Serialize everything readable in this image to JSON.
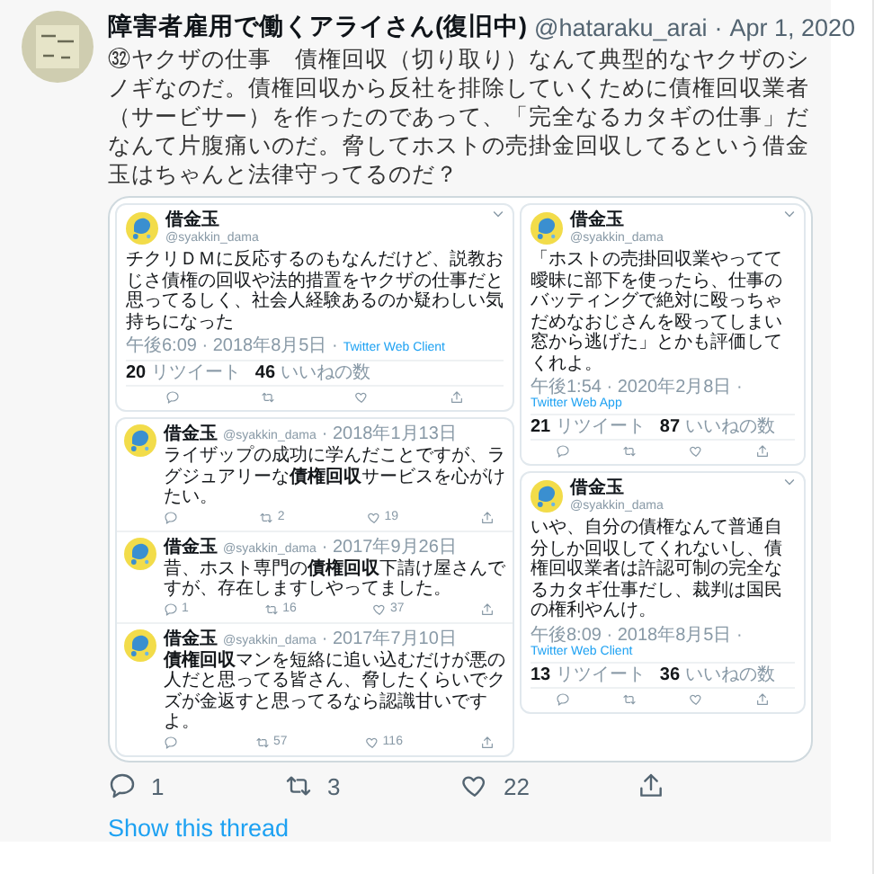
{
  "tweet": {
    "author": "障害者雇用で働くアライさん(復旧中)",
    "handle": "@hataraku_arai",
    "separator": "·",
    "date": "Apr 1, 2020",
    "text": "㉜ヤクザの仕事　債権回収（切り取り）なんて典型的なヤクザのシノギなのだ。債権回収から反社を排除していくために債権回収業者（サービサー）を作ったのであって、「完全なるカタギの仕事」だなんて片腹痛いのだ。脅してホストの売掛金回収してるという借金玉はちゃんと法律守ってるのだ？",
    "image": {
      "columns": [
        {
          "cards": [
            {
              "kind": "detail",
              "name": "借金玉",
              "handle": "@syakkin_dama",
              "text": "チクリＤＭに反応するのもなんだけど、説教おじさ債権の回収や法的措置をヤクザの仕事だと思ってるしく、社会人経験あるのか疑わしい気持ちになった",
              "time": "午後6:09 · 2018年8月5日 ·",
              "app": "Twitter Web Client",
              "stats": [
                {
                  "count": "20",
                  "label": "リツイート"
                },
                {
                  "count": "46",
                  "label": "いいねの数"
                }
              ]
            },
            {
              "kind": "replies",
              "items": [
                {
                  "name": "借金玉",
                  "handle": "@syakkin_dama",
                  "date": "· 2018年1月13日",
                  "text": "ライザップの成功に学んだことですが、ラグジュアリーな**債権回収**サービスを心がけたい。",
                  "actions": [
                    {
                      "kind": "reply"
                    },
                    {
                      "kind": "retweet",
                      "count": "2"
                    },
                    {
                      "kind": "like",
                      "count": "19"
                    },
                    {
                      "kind": "share"
                    }
                  ]
                },
                {
                  "name": "借金玉",
                  "handle": "@syakkin_dama",
                  "date": "· 2017年9月26日",
                  "text": "昔、ホスト専門の**債権回収**下請け屋さんですが、存在しますしやってました。",
                  "actions": [
                    {
                      "kind": "reply",
                      "count": "1"
                    },
                    {
                      "kind": "retweet",
                      "count": "16"
                    },
                    {
                      "kind": "like",
                      "count": "37"
                    },
                    {
                      "kind": "share"
                    }
                  ]
                },
                {
                  "name": "借金玉",
                  "handle": "@syakkin_dama",
                  "date": "· 2017年7月10日",
                  "text": "**債権回収**マンを短絡に追い込むだけが悪の人だと思ってる皆さん、脅したくらいでクズが金返すと思ってるなら認識甘いですよ。",
                  "actions": [
                    {
                      "kind": "reply"
                    },
                    {
                      "kind": "retweet",
                      "count": "57"
                    },
                    {
                      "kind": "like",
                      "count": "116"
                    },
                    {
                      "kind": "share"
                    }
                  ]
                }
              ]
            }
          ]
        },
        {
          "cards": [
            {
              "kind": "detail",
              "name": "借金玉",
              "handle": "@syakkin_dama",
              "text": "「ホストの売掛回収業やってて曖昧に部下を使ったら、仕事のバッティングで絶対に殴っちゃだめなおじさんを殴ってしまい窓から逃げた」とかも評価してくれよ。",
              "time": "午後1:54 · 2020年2月8日 ·",
              "app": "Twitter Web App",
              "stats": [
                {
                  "count": "21",
                  "label": "リツイート"
                },
                {
                  "count": "87",
                  "label": "いいねの数"
                }
              ]
            },
            {
              "kind": "detail",
              "name": "借金玉",
              "handle": "@syakkin_dama",
              "text": "いや、自分の債権なんて普通自分しか回収してくれないし、債権回収業者は許認可制の完全なるカタギ仕事だし、裁判は国民の権利やんけ。",
              "time": "午後8:09 · 2018年8月5日 ·",
              "app": "Twitter Web Client",
              "stats": [
                {
                  "count": "13",
                  "label": "リツイート"
                },
                {
                  "count": "36",
                  "label": "いいねの数"
                }
              ]
            }
          ]
        }
      ]
    },
    "actions": [
      {
        "kind": "reply",
        "count": "1"
      },
      {
        "kind": "retweet",
        "count": "3"
      },
      {
        "kind": "like",
        "count": "22"
      },
      {
        "kind": "share"
      }
    ],
    "show_thread": "Show this thread"
  }
}
